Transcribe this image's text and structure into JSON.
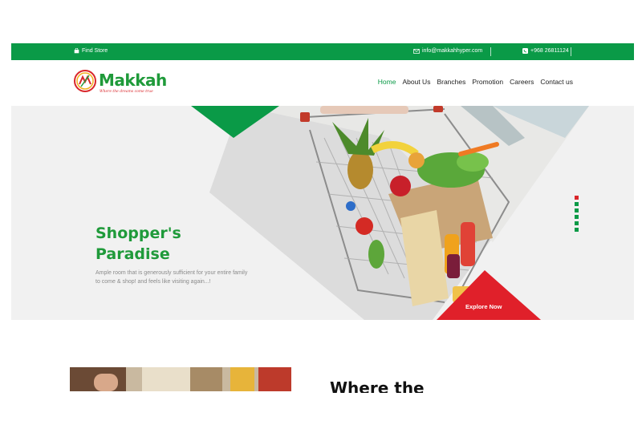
{
  "topbar": {
    "find_store": "Find Store",
    "email": "info@makkahhyper.com",
    "phone": "+968 26811124"
  },
  "brand": {
    "name": "Makkah",
    "tagline": "Where the dreams come true",
    "green": "#0a9a47",
    "red": "#d9262a"
  },
  "nav": {
    "items": [
      "Home",
      "About Us",
      "Branches",
      "Promotion",
      "Careers",
      "Contact us"
    ],
    "active": "Home"
  },
  "hero": {
    "title_line1": "Shopper's",
    "title_line2": "Paradise",
    "text": "Ample room that is generously sufficient for your entire family to come & shop! and feels like visiting again...!",
    "cta": "Explore Now"
  },
  "slider": {
    "count": 6,
    "active_index": 0
  },
  "section": {
    "heading": "Where the"
  }
}
